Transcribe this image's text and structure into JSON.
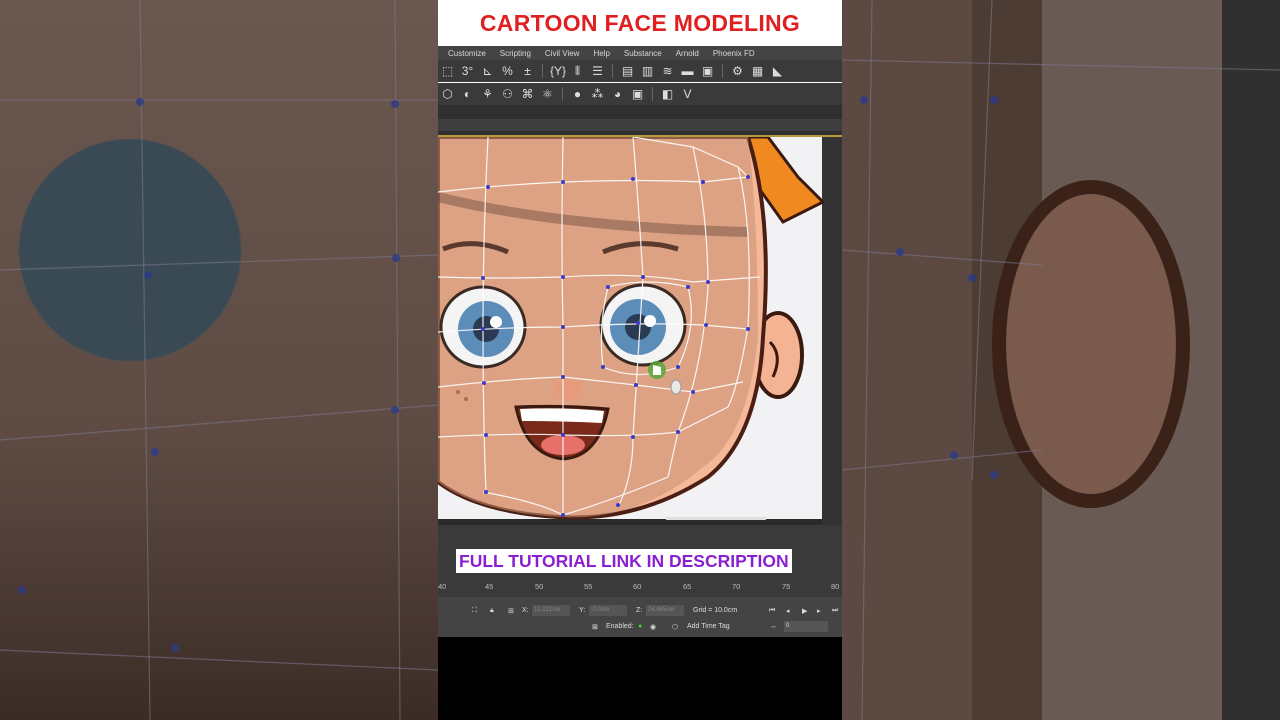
{
  "title": "CARTOON FACE MODELING",
  "menu": [
    "Customize",
    "Scripting",
    "Civil View",
    "Help",
    "Substance",
    "Arnold",
    "Phoenix FD"
  ],
  "toolbar_row1": [
    "select-icon",
    "snap-3d-icon",
    "angle-snap-icon",
    "percent-snap-icon",
    "spinner-snap-icon",
    "named-selection-icon",
    "mirror-icon",
    "align-icon",
    "layer-manager-icon",
    "scene-explorer-icon",
    "curve-editor-icon",
    "schematic-view-icon",
    "material-editor-icon",
    "render-setup-icon",
    "render-frame-icon",
    "render-icon",
    "teapot-icon"
  ],
  "toolbar_row2": [
    "box-icon",
    "sphere-icon",
    "modifier-icon",
    "hierarchy-icon",
    "motion-icon",
    "display-icon",
    "material-ball-icon",
    "color-grid-icon",
    "palette-icon",
    "slate-icon",
    "render-toggle-icon",
    "vray-icon"
  ],
  "toolbar_row1_glyphs": [
    "⬚",
    "3°",
    "⊾",
    "%",
    "±",
    "{Y}",
    "⫴",
    "☰",
    "▤",
    "▥",
    "≋",
    "▬",
    "▣",
    "⚙",
    "▦",
    "◣"
  ],
  "toolbar_row2_glyphs": [
    "⬡",
    "◐",
    "⚘",
    "⚇",
    "⌘",
    "⚛",
    "●",
    "⁂",
    "◕",
    "▣",
    "◧",
    "V"
  ],
  "banner": "FULL TUTORIAL LINK IN DESCRIPTION",
  "ruler_ticks": [
    "40",
    "45",
    "50",
    "55",
    "60",
    "65",
    "70",
    "75",
    "80"
  ],
  "status": {
    "x_label": "X:",
    "x_value": "12.221cm",
    "y_label": "Y:",
    "y_value": "-0.0cm",
    "z_label": "Z:",
    "z_value": "24.465cm",
    "grid": "Grid = 10.0cm",
    "enabled_label": "Enabled:",
    "add_time_tag": "Add Time Tag",
    "frame_value": "0"
  },
  "colors": {
    "title_red": "#e02020",
    "banner_purple": "#8a1fd0",
    "ui_dark": "#3a3a3a",
    "mesh_line": "#ffffff",
    "mesh_vertex": "#3a3acc"
  }
}
